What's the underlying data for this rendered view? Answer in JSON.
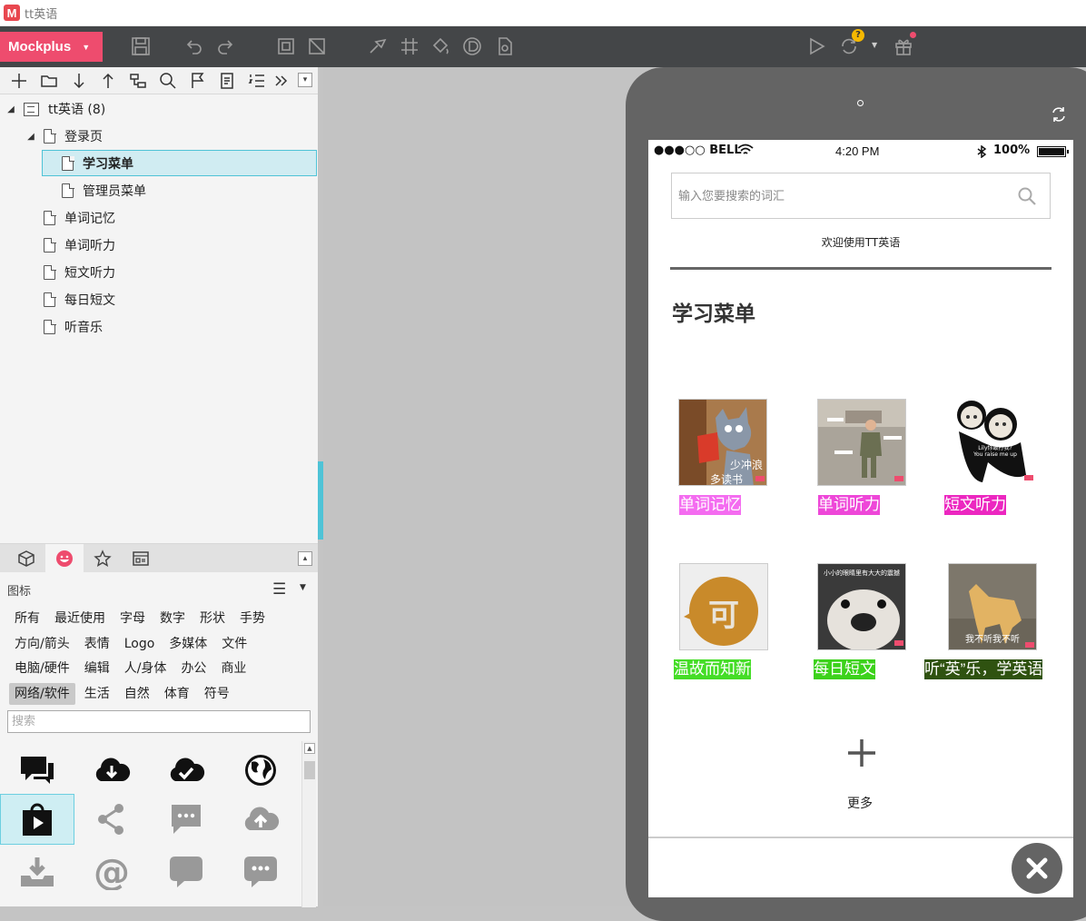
{
  "window": {
    "title": "tt英语",
    "logo_letter": "M"
  },
  "toolbar": {
    "brand_label": "Mockplus",
    "brand_caret": "▼"
  },
  "tree": {
    "root": {
      "label": "tt英语 (8)"
    },
    "items": [
      {
        "label": "登录页"
      },
      {
        "label": "学习菜单"
      },
      {
        "label": "管理员菜单"
      },
      {
        "label": "单词记忆"
      },
      {
        "label": "单词听力"
      },
      {
        "label": "短文听力"
      },
      {
        "label": "每日短文"
      },
      {
        "label": "听音乐"
      }
    ]
  },
  "library": {
    "label": "图标",
    "categories": [
      [
        "所有",
        "最近使用",
        "字母",
        "数字",
        "形状",
        "手势"
      ],
      [
        "方向/箭头",
        "表情",
        "Logo",
        "多媒体",
        "文件"
      ],
      [
        "电脑/硬件",
        "编辑",
        "人/身体",
        "办公",
        "商业"
      ],
      [
        "网络/软件",
        "生活",
        "自然",
        "体育",
        "符号"
      ]
    ],
    "selected_category": "网络/软件",
    "search_placeholder": "搜索",
    "icons": [
      "chat-bubbles-icon",
      "cloud-download-icon",
      "cloud-check-icon",
      "globe-icon",
      "play-bag-icon",
      "share-icon",
      "comment-dots-icon",
      "cloud-upload-icon",
      "inbox-download-icon",
      "at-sign-icon",
      "speech-bubble-icon",
      "speech-dots-icon"
    ]
  },
  "phone": {
    "status": {
      "carrier": "●●●○○ BELL",
      "time": "4:20 PM",
      "battery": "100%"
    },
    "search_placeholder": "输入您要搜索的词汇",
    "welcome": "欢迎使用TT英语",
    "section_title": "学习菜单",
    "cards": [
      {
        "label": "单词记忆",
        "label_bg": "#f46cf0",
        "img_caption": "少冲浪\n多读书"
      },
      {
        "label": "单词听力",
        "label_bg": "#ee47d8"
      },
      {
        "label": "短文听力",
        "label_bg": "#ec27c0",
        "img_caption": "Lily你敢打我?"
      },
      {
        "label": "温故而知新",
        "label_bg": "#45dd27",
        "img_glyph": "可"
      },
      {
        "label": "每日短文",
        "label_bg": "#3cd21b",
        "img_caption": "小小的眼睛里有大大的震撼"
      },
      {
        "label": "听“英”乐，学英语",
        "label_bg": "#2f5210",
        "img_caption": "我不听我不听"
      }
    ],
    "more_label": "更多"
  },
  "colors": {
    "accent": "#ee4c6e",
    "selection": "#4fc3d6",
    "toolbar_bg": "#444648",
    "phone_shell": "#646464"
  }
}
